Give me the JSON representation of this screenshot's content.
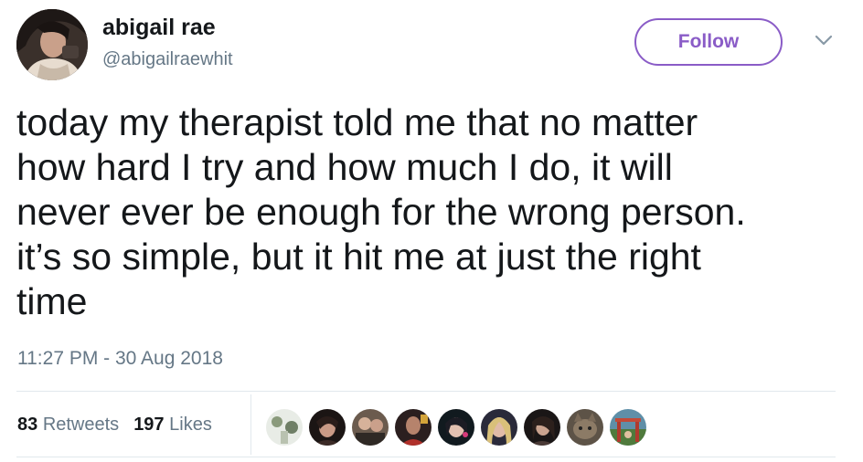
{
  "author": {
    "display_name": "abigail rae",
    "handle": "@abigailraewhit"
  },
  "follow_button": {
    "label": "Follow"
  },
  "more_menu": {
    "icon": "chevron-down-icon"
  },
  "tweet": {
    "text": "today my therapist told me that no matter\nhow hard I try and how much I do, it will\nnever ever be enough for the wrong person.\nit’s so simple, but it hit me at just the right\ntime",
    "timestamp": "11:27 PM - 30 Aug 2018"
  },
  "stats": {
    "retweets_count": "83",
    "retweets_label": "Retweets",
    "likes_count": "197",
    "likes_label": "Likes"
  },
  "liker_avatars": [
    {
      "name": "liker-avatar-1"
    },
    {
      "name": "liker-avatar-2"
    },
    {
      "name": "liker-avatar-3"
    },
    {
      "name": "liker-avatar-4"
    },
    {
      "name": "liker-avatar-5"
    },
    {
      "name": "liker-avatar-6"
    },
    {
      "name": "liker-avatar-7"
    },
    {
      "name": "liker-avatar-8"
    },
    {
      "name": "liker-avatar-9"
    }
  ],
  "colors": {
    "accent": "#8a5cc7",
    "text": "#14171a",
    "secondary_text": "#657786",
    "divider": "#e1e8ed"
  }
}
